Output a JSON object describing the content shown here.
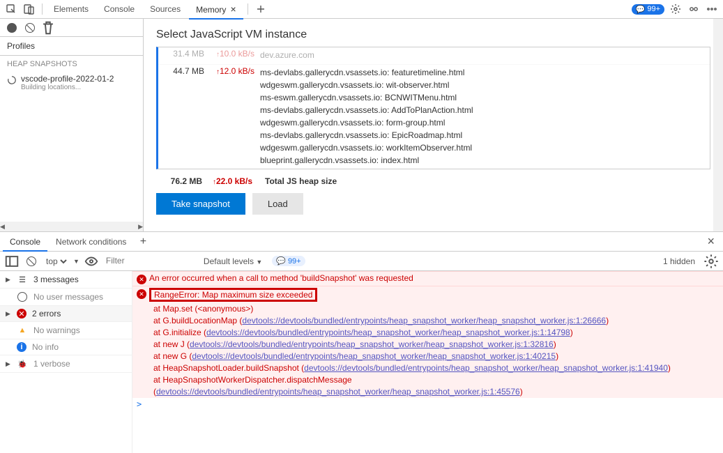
{
  "topTabs": {
    "elements": "Elements",
    "console": "Console",
    "sources": "Sources",
    "memory": "Memory",
    "badge": "99+"
  },
  "sidebar": {
    "profiles": "Profiles",
    "snapHeader": "HEAP SNAPSHOTS",
    "item": {
      "title": "vscode-profile-2022-01-2",
      "sub": "Building locations..."
    }
  },
  "memory": {
    "heading": "Select JavaScript VM instance",
    "rows": [
      {
        "size": "31.4 MB",
        "rate": "10.0 kB/s",
        "urls": [
          "dev.azure.com"
        ]
      },
      {
        "size": "44.7 MB",
        "rate": "12.0 kB/s",
        "urls": [
          "ms-devlabs.gallerycdn.vsassets.io: featuretimeline.html",
          "wdgeswm.gallerycdn.vsassets.io: wit-observer.html",
          "ms-eswm.gallerycdn.vsassets.io: BCNWITMenu.html",
          "ms-devlabs.gallerycdn.vsassets.io: AddToPlanAction.html",
          "wdgeswm.gallerycdn.vsassets.io: form-group.html",
          "ms-devlabs.gallerycdn.vsassets.io: EpicRoadmap.html",
          "wdgeswm.gallerycdn.vsassets.io: workItemObserver.html",
          "blueprint.gallerycdn.vsassets.io: index.html"
        ]
      }
    ],
    "total": {
      "size": "76.2 MB",
      "rate": "22.0 kB/s",
      "label": "Total JS heap size"
    },
    "takeSnapshot": "Take snapshot",
    "load": "Load"
  },
  "drawer": {
    "console": "Console",
    "network": "Network conditions"
  },
  "consoleToolbar": {
    "context": "top",
    "filterPlaceholder": "Filter",
    "levels": "Default levels",
    "issues": "99+",
    "hidden": "1 hidden"
  },
  "msgSide": {
    "messages": "3 messages",
    "user": "No user messages",
    "errors": "2 errors",
    "warnings": "No warnings",
    "info": "No info",
    "verbose": "1 verbose"
  },
  "console": {
    "err1": "An error occurred when a call to method 'buildSnapshot' was requested",
    "err2": "RangeError: Map maximum size exceeded",
    "t1": "at Map.set (<anonymous>)",
    "t2a": "at G.buildLocationMap (",
    "t2l": "devtools://devtools/bundled/entrypoints/heap_snapshot_worker/heap_snapshot_worker.js:1:26666",
    "t3a": "at G.initialize (",
    "t3l": "devtools://devtools/bundled/entrypoints/heap_snapshot_worker/heap_snapshot_worker.js:1:14798",
    "t4a": "at new J (",
    "t4l": "devtools://devtools/bundled/entrypoints/heap_snapshot_worker/heap_snapshot_worker.js:1:32816",
    "t5a": "at new G (",
    "t5l": "devtools://devtools/bundled/entrypoints/heap_snapshot_worker/heap_snapshot_worker.js:1:40215",
    "t6a": "at HeapSnapshotLoader.buildSnapshot (",
    "t6l": "devtools://devtools/bundled/entrypoints/heap_snapshot_worker/heap_snapshot_worker.js:1:41940",
    "t7a": "at HeapSnapshotWorkerDispatcher.dispatchMessage (",
    "t7l": "devtools://devtools/bundled/entrypoints/heap_snapshot_worker/heap_snapshot_worker.js:1:45576",
    "prompt": ">"
  }
}
